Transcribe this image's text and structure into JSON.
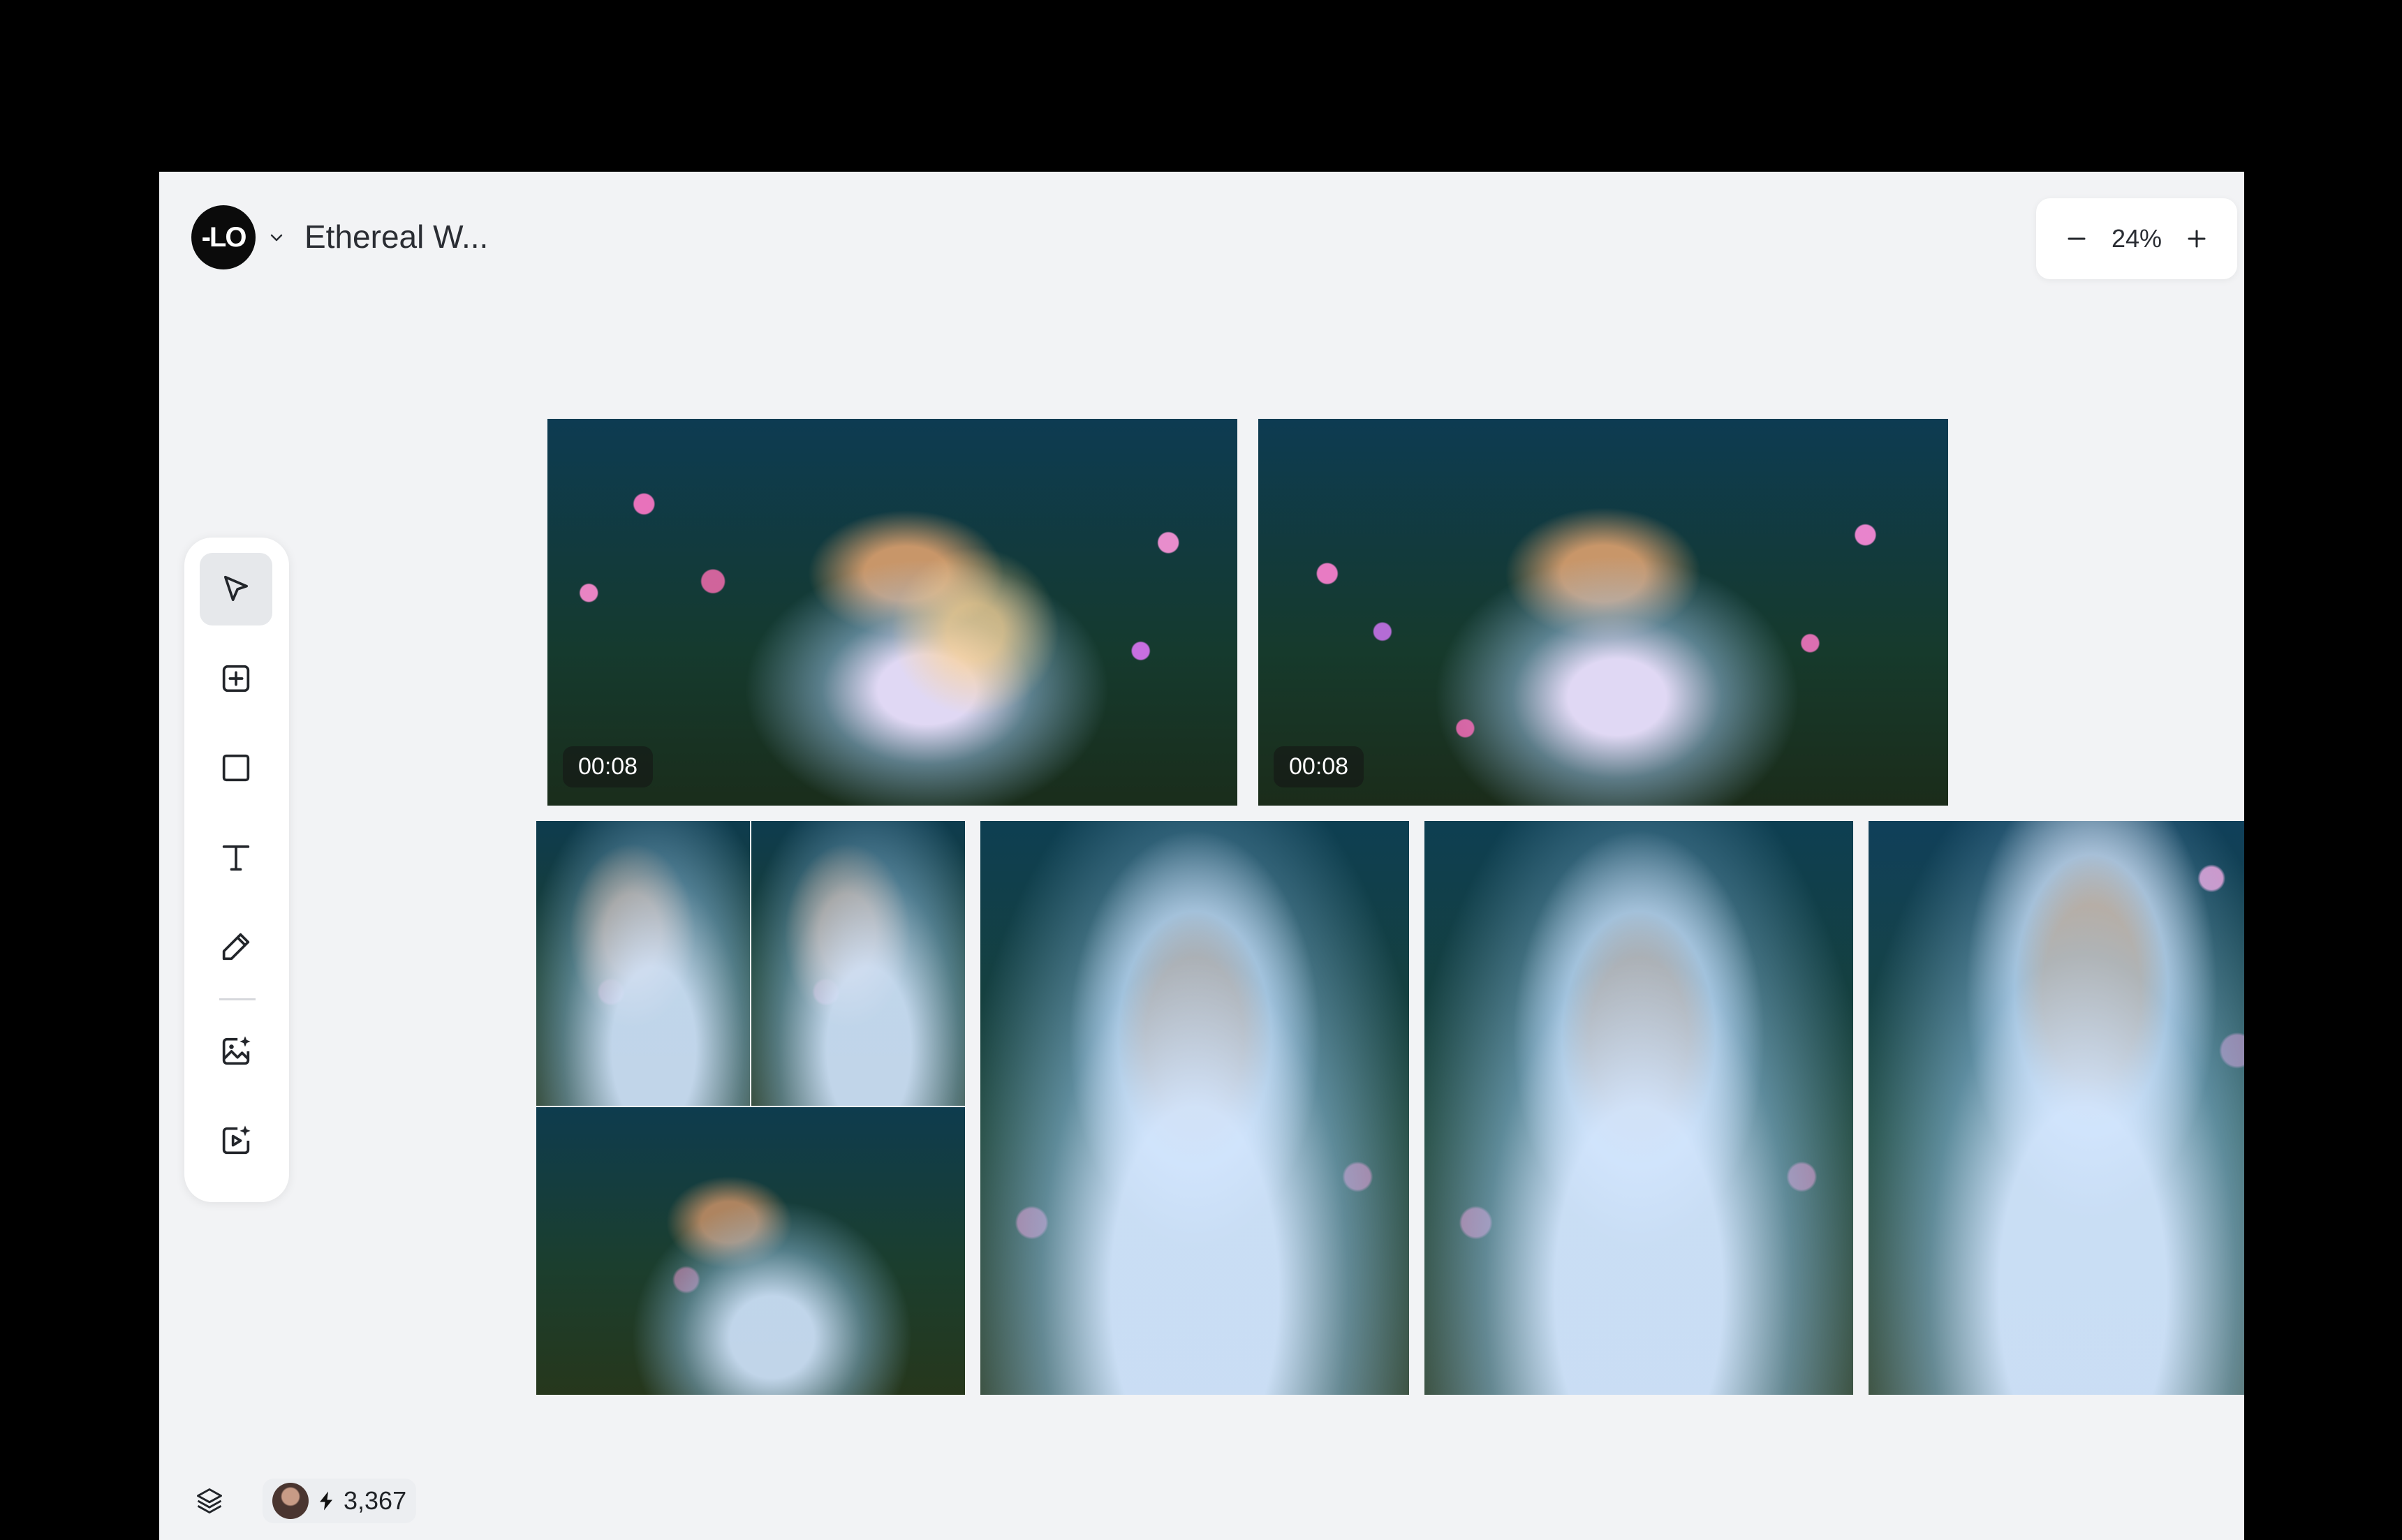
{
  "header": {
    "logo_text": "-LO",
    "project_title": "Ethereal W..."
  },
  "zoom": {
    "minus_label": "−",
    "value": "24%",
    "plus_label": "+"
  },
  "toolbar": {
    "tools": [
      {
        "name": "select",
        "icon": "cursor-icon",
        "active": true
      },
      {
        "name": "add-frame",
        "icon": "plus-square-icon",
        "active": false
      },
      {
        "name": "rectangle",
        "icon": "square-icon",
        "active": false
      },
      {
        "name": "text",
        "icon": "text-icon",
        "active": false
      },
      {
        "name": "pencil",
        "icon": "pencil-icon",
        "active": false
      },
      {
        "name": "generate-image",
        "icon": "image-sparkle-icon",
        "active": false
      },
      {
        "name": "generate-video",
        "icon": "video-sparkle-icon",
        "active": false
      }
    ]
  },
  "canvas": {
    "videos": [
      {
        "duration": "00:08"
      },
      {
        "duration": "00:08"
      }
    ]
  },
  "footer": {
    "credits": "3,367"
  }
}
